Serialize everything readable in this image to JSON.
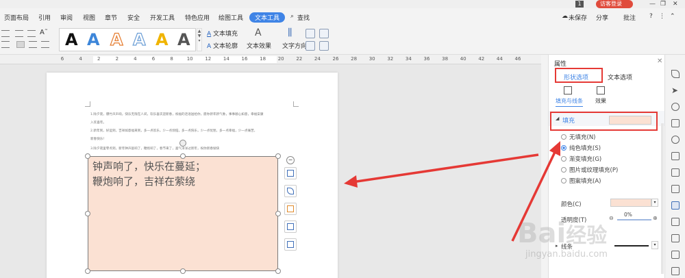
{
  "titlebar": {
    "page_badge": "1",
    "login": "访客登录"
  },
  "menu": {
    "items": [
      "页面布局",
      "引用",
      "审阅",
      "视图",
      "章节",
      "安全",
      "开发工具",
      "特色应用",
      "绘图工具",
      "文本工具"
    ],
    "active": "文本工具",
    "search": "查找",
    "right": {
      "unsaved": "未保存",
      "share": "分享",
      "annotate": "批注",
      "help": "?"
    }
  },
  "toolbar": {
    "gallery_letters": [
      "A",
      "A",
      "A",
      "A",
      "A",
      "A"
    ],
    "gallery_colors": [
      "#111111",
      "#3d86d9",
      "#e57c2f",
      "#6b9ed6",
      "#f0b400",
      "#555555"
    ],
    "text_fill": "文本填充",
    "text_outline": "文本轮廓",
    "text_effect": "文本效果",
    "text_direction": "文字方向"
  },
  "ruler": {
    "numbers": [
      "6",
      "4",
      "2",
      "2",
      "4",
      "6",
      "8",
      "10",
      "12",
      "14",
      "16",
      "18",
      "20",
      "22",
      "24",
      "26",
      "28",
      "30",
      "32",
      "34",
      "36",
      "38",
      "40",
      "42",
      "44",
      "46"
    ]
  },
  "document": {
    "paragraphs": [
      "1.除夕夜，爆竹声声响，快乐无限在人间，欢乐喜庆迎新春，祝福的话语送给你，愿你新年新气象，事事顺心如意，幸福安康",
      "入欢喜年。",
      "2.新年到，好运到，吉祥如意福来到，多一点欢乐，少一点烦恼，多一点快乐，少一点忧愁，多一点幸福，少一点痛苦，",
      "新春快乐！",
      "3.除夕夜里零点到，新年钟声敲响了，鞭炮响了，春节来了，喜气洋洋过新年，祝你新春愉快"
    ],
    "textbox_lines": [
      "钟声响了，快乐在蔓延；",
      "鞭炮响了，吉祥在萦绕"
    ]
  },
  "panel": {
    "title": "属性",
    "tabs": {
      "shape": "形状选项",
      "text": "文本选项"
    },
    "subtabs": {
      "fill_line": "填充与线条",
      "effect": "效果"
    },
    "fill_section": "填充",
    "fill_color": "#fbe1d3",
    "options": [
      {
        "label": "无填充(N)",
        "selected": false
      },
      {
        "label": "纯色填充(S)",
        "selected": true
      },
      {
        "label": "渐变填充(G)",
        "selected": false
      },
      {
        "label": "图片或纹理填充(P)",
        "selected": false
      },
      {
        "label": "图案填充(A)",
        "selected": false
      }
    ],
    "color_label": "颜色(C)",
    "transparency_label": "透明度(T)",
    "transparency_value": "0%",
    "line_label": "线条"
  },
  "watermark": {
    "url": "jingyan.baidu.com"
  }
}
